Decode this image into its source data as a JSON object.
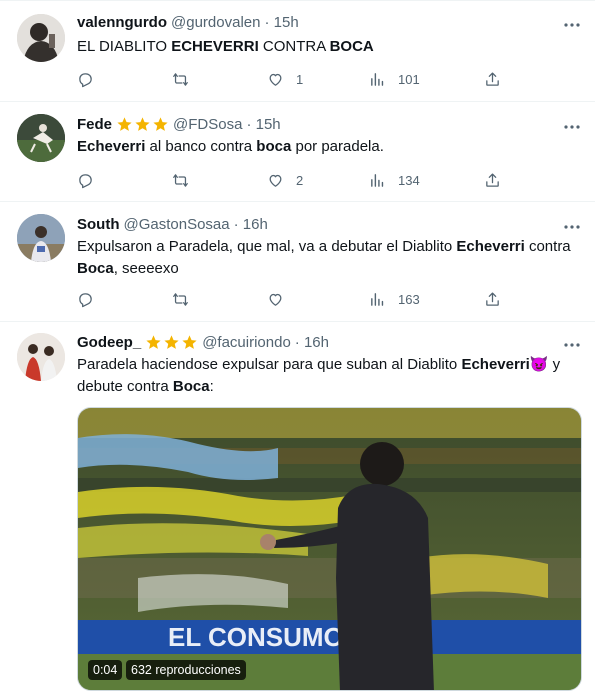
{
  "tweets": [
    {
      "name": "valenngurdo",
      "handle": "@gurdovalen",
      "time": "· 15h",
      "text_segments": [
        {
          "text": "EL DIABLITO ",
          "bold": false
        },
        {
          "text": "ECHEVERRI",
          "bold": true
        },
        {
          "text": " CONTRA ",
          "bold": false
        },
        {
          "text": "BOCA",
          "bold": true
        }
      ],
      "counts": {
        "replies": "",
        "retweets": "",
        "likes": "1",
        "views": "101"
      },
      "stars": 0
    },
    {
      "name": "Fede",
      "handle": "@FDSosa",
      "time": "· 15h",
      "text_segments": [
        {
          "text": "Echeverri",
          "bold": true
        },
        {
          "text": " al banco contra ",
          "bold": false
        },
        {
          "text": "boca",
          "bold": true
        },
        {
          "text": " por paradela.",
          "bold": false
        }
      ],
      "counts": {
        "replies": "",
        "retweets": "",
        "likes": "2",
        "views": "134"
      },
      "stars": 3
    },
    {
      "name": "South",
      "handle": "@GastonSosaa",
      "time": "· 16h",
      "text_segments": [
        {
          "text": "Expulsaron a Paradela, que mal, va a debutar el Diablito ",
          "bold": false
        },
        {
          "text": "Echeverri",
          "bold": true
        },
        {
          "text": " contra ",
          "bold": false
        },
        {
          "text": "Boca",
          "bold": true
        },
        {
          "text": ", seeeexo",
          "bold": false
        }
      ],
      "counts": {
        "replies": "",
        "retweets": "",
        "likes": "",
        "views": "163"
      },
      "stars": 0
    },
    {
      "name": "Godeep_",
      "handle": "@facuiriondo",
      "time": "· 16h",
      "text_segments": [
        {
          "text": "Paradela haciendose expulsar para que suban al Diablito ",
          "bold": false
        },
        {
          "text": "Echeverri",
          "bold": true
        },
        {
          "text": "😈",
          "bold": false,
          "emoji": true
        },
        {
          "text": " y debute contra ",
          "bold": false
        },
        {
          "text": "Boca",
          "bold": true
        },
        {
          "text": ":",
          "bold": false
        }
      ],
      "counts": {
        "replies": "",
        "retweets": "",
        "likes": "",
        "views": ""
      },
      "stars": 3,
      "video": {
        "duration": "0:04",
        "views_label": "632 reproducciones",
        "banner_text": "EL CONSUMO       LUZ"
      }
    }
  ],
  "icons": [
    "reply-icon",
    "retweet-icon",
    "like-icon",
    "views-icon",
    "share-icon",
    "more-icon",
    "star-icon"
  ],
  "colors": {
    "text": "#0f1419",
    "muted": "#536471",
    "divider": "#eff3f4",
    "star": "#f4b400"
  }
}
